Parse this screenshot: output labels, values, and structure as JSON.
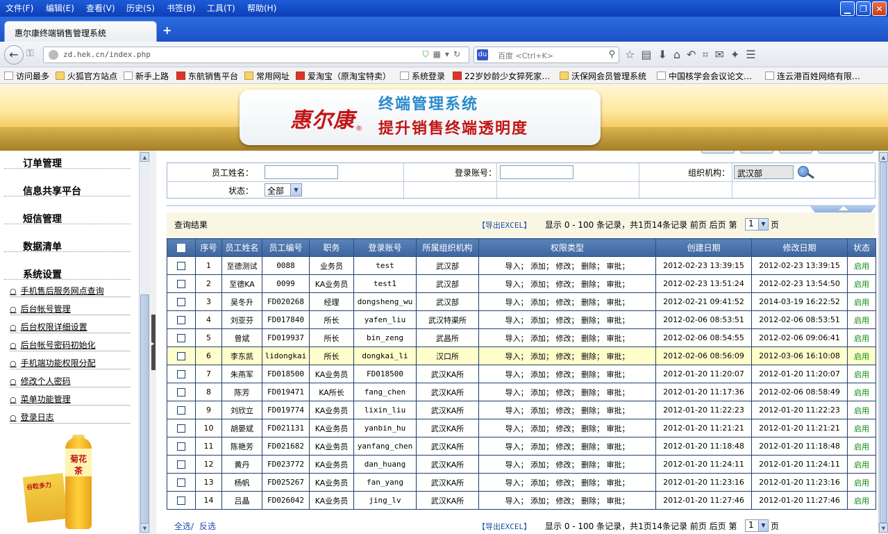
{
  "browser": {
    "menu": [
      "文件(F)",
      "编辑(E)",
      "查看(V)",
      "历史(S)",
      "书签(B)",
      "工具(T)",
      "帮助(H)"
    ],
    "tab_title": "惠尔康终端销售管理系统",
    "url": "zd.hek.cn/index.php",
    "search_engine": "百度",
    "search_placeholder": "<Ctrl+K>",
    "bookmarks": [
      "访问最多",
      "火狐官方站点",
      "新手上路",
      "东航销售平台",
      "常用网址",
      "爱淘宝（原淘宝特卖）",
      "系统登录",
      "22岁妙龄少女猝死家…",
      "沃保网会员管理系统",
      "中国核学会会议论文…",
      "连云港百姓网络有限…"
    ]
  },
  "banner": {
    "logo": "惠尔康",
    "logo_mark": "®",
    "system_name": "终端管理系统",
    "slogan": "提升销售终端透明度"
  },
  "sidebar": {
    "titles": [
      "订单管理",
      "信息共享平台",
      "短信管理",
      "数据清单",
      "系统设置"
    ],
    "items": [
      "手机售后服务网点查询",
      "后台帐号管理",
      "后台权限详细设置",
      "后台帐号密码初始化",
      "手机端功能权限分配",
      "修改个人密码",
      "菜单功能管理",
      "登录日志"
    ],
    "bullet": "○",
    "product_box_text": "谷粒多力",
    "product_bottle_text": "菊花茶"
  },
  "search": {
    "name_label": "员工姓名：",
    "name_value": "",
    "account_label": "登录账号：",
    "account_value": "",
    "org_label": "组织机构：",
    "org_value": "武汉部",
    "status_label": "状态：",
    "status_value": "全部"
  },
  "results": {
    "title": "查询结果",
    "export_label": "【导出EXCEL】",
    "info": "显示 0 - 100 条记录，共1页14条记录 前页 后页 第",
    "page": "1",
    "page_suffix": "页"
  },
  "table": {
    "columns": [
      "序号",
      "员工姓名",
      "员工编号",
      "职务",
      "登录账号",
      "所属组织机构",
      "权限类型",
      "创建日期",
      "修改日期",
      "状态"
    ],
    "rows": [
      [
        "1",
        "至德测试",
        "0088",
        "业务员",
        "test",
        "武汉部",
        "导入； 添加； 修改； 删除； 审批；",
        "2012-02-23 13:39:15",
        "2012-02-23 13:39:15",
        "启用"
      ],
      [
        "2",
        "至德KA",
        "0099",
        "KA业务员",
        "test1",
        "武汉部",
        "导入； 添加； 修改； 删除； 审批；",
        "2012-02-23 13:51:24",
        "2012-02-23 13:54:50",
        "启用"
      ],
      [
        "3",
        "吴冬升",
        "FD020268",
        "经理",
        "dongsheng_wu",
        "武汉部",
        "导入； 添加； 修改； 删除； 审批；",
        "2012-02-21 09:41:52",
        "2014-03-19 16:22:52",
        "启用"
      ],
      [
        "4",
        "刘亚芬",
        "FD017840",
        "所长",
        "yafen_liu",
        "武汉特渠所",
        "导入； 添加； 修改； 删除； 审批；",
        "2012-02-06 08:53:51",
        "2012-02-06 08:53:51",
        "启用"
      ],
      [
        "5",
        "曾斌",
        "FD019937",
        "所长",
        "bin_zeng",
        "武昌所",
        "导入； 添加； 修改； 删除； 审批；",
        "2012-02-06 08:54:55",
        "2012-02-06 09:06:41",
        "启用"
      ],
      [
        "6",
        "李东凯",
        "lidongkai",
        "所长",
        "dongkai_li",
        "汉口所",
        "导入； 添加； 修改； 删除； 审批；",
        "2012-02-06 08:56:09",
        "2012-03-06 16:10:08",
        "启用"
      ],
      [
        "7",
        "朱燕军",
        "FD018500",
        "KA业务员",
        "FD018500",
        "武汉KA所",
        "导入； 添加； 修改； 删除； 审批；",
        "2012-01-20 11:20:07",
        "2012-01-20 11:20:07",
        "启用"
      ],
      [
        "8",
        "陈芳",
        "FD019471",
        "KA所长",
        "fang_chen",
        "武汉KA所",
        "导入； 添加； 修改； 删除； 审批；",
        "2012-01-20 11:17:36",
        "2012-02-06 08:58:49",
        "启用"
      ],
      [
        "9",
        "刘欣立",
        "FD019774",
        "KA业务员",
        "lixin_liu",
        "武汉KA所",
        "导入； 添加； 修改； 删除； 审批；",
        "2012-01-20 11:22:23",
        "2012-01-20 11:22:23",
        "启用"
      ],
      [
        "10",
        "胡晏斌",
        "FD021131",
        "KA业务员",
        "yanbin_hu",
        "武汉KA所",
        "导入； 添加； 修改； 删除； 审批；",
        "2012-01-20 11:21:21",
        "2012-01-20 11:21:21",
        "启用"
      ],
      [
        "11",
        "陈艳芳",
        "FD021682",
        "KA业务员",
        "yanfang_chen",
        "武汉KA所",
        "导入； 添加； 修改； 删除； 审批；",
        "2012-01-20 11:18:48",
        "2012-01-20 11:18:48",
        "启用"
      ],
      [
        "12",
        "黄丹",
        "FD023772",
        "KA业务员",
        "dan_huang",
        "武汉KA所",
        "导入； 添加； 修改； 删除； 审批；",
        "2012-01-20 11:24:11",
        "2012-01-20 11:24:11",
        "启用"
      ],
      [
        "13",
        "杨帆",
        "FD025267",
        "KA业务员",
        "fan_yang",
        "武汉KA所",
        "导入； 添加； 修改； 删除； 审批；",
        "2012-01-20 11:23:16",
        "2012-01-20 11:23:16",
        "启用"
      ],
      [
        "14",
        "吕晶",
        "FD026042",
        "KA业务员",
        "jing_lv",
        "武汉KA所",
        "导入； 添加； 修改； 删除； 审批；",
        "2012-01-20 11:27:46",
        "2012-01-20 11:27:46",
        "启用"
      ]
    ],
    "highlighted_row": 6
  },
  "bottom": {
    "select_all": "全选/",
    "invert": "反选"
  },
  "colors": {
    "header_blue": "#3d659f",
    "status_green": "#0a8a0a",
    "highlight_row": "#ffffcc",
    "brand_red": "#c21414"
  }
}
